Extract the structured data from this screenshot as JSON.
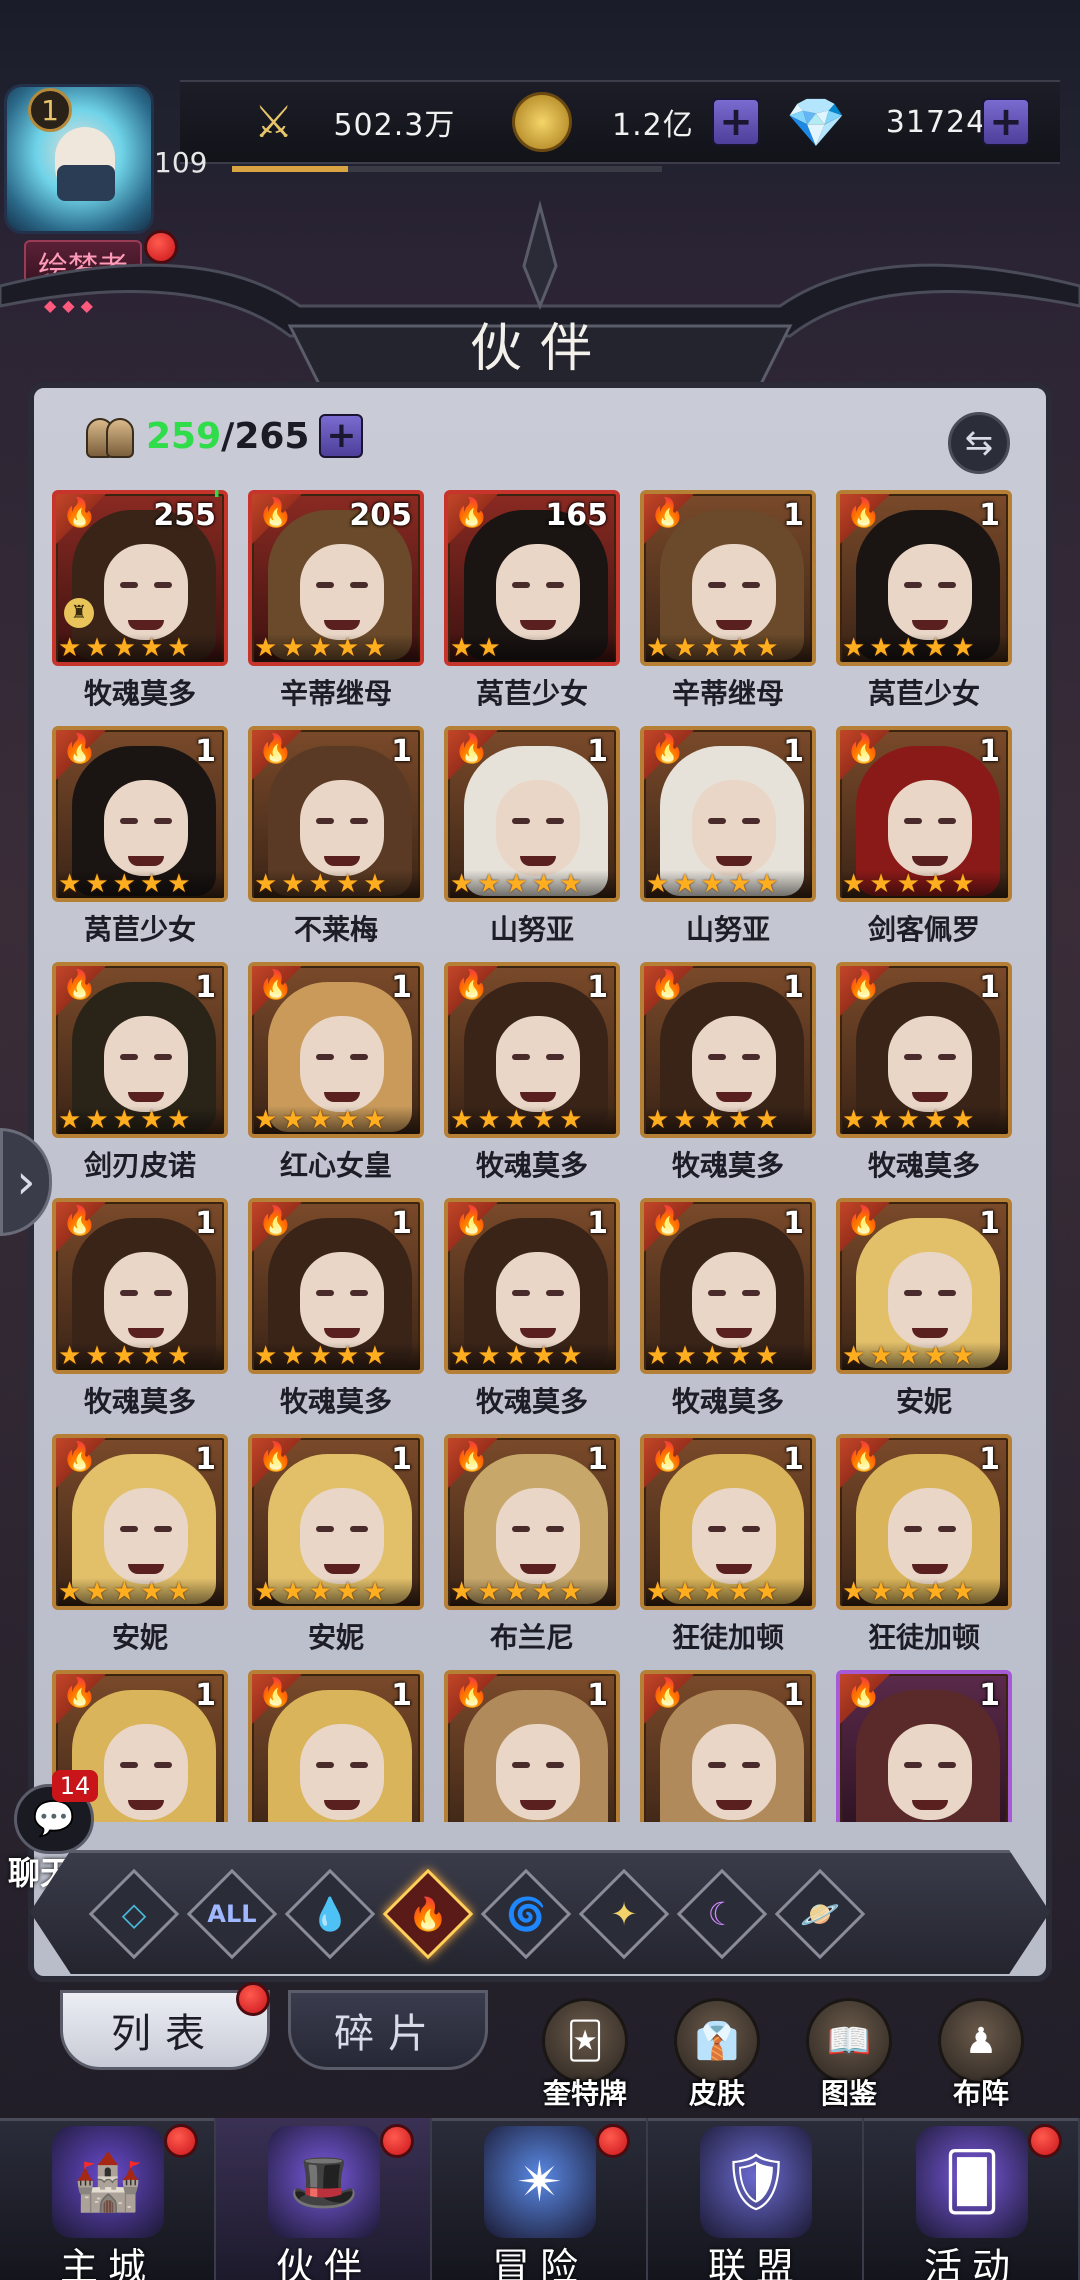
{
  "header": {
    "player_level": "109",
    "vip_level": "1",
    "title_badge": "绘梦者",
    "xp_progress": 0.27,
    "resources": [
      {
        "name": "power",
        "icon": "sword-icon",
        "value": "502.3万"
      },
      {
        "name": "gold",
        "icon": "coin-icon",
        "value": "1.2亿"
      },
      {
        "name": "diamond",
        "icon": "diamond-icon",
        "value": "31724"
      }
    ],
    "plus_symbol": "+"
  },
  "page": {
    "title": "伙伴",
    "owned": "259",
    "slash": "/",
    "capacity": "265",
    "sort_icon": "⇆"
  },
  "heroes": [
    {
      "name": "牧魂莫多",
      "level": "255",
      "stars": 5,
      "frame": "red",
      "hair": "#3a2418",
      "upgrade": true,
      "locked": true
    },
    {
      "name": "辛蒂继母",
      "level": "205",
      "stars": 5,
      "frame": "red",
      "hair": "#6a4a2a"
    },
    {
      "name": "莴苣少女",
      "level": "165",
      "stars": 2,
      "frame": "red",
      "hair": "#1a1412"
    },
    {
      "name": "辛蒂继母",
      "level": "1",
      "stars": 5,
      "frame": "gold",
      "hair": "#6a4a2a"
    },
    {
      "name": "莴苣少女",
      "level": "1",
      "stars": 5,
      "frame": "gold",
      "hair": "#1a1412"
    },
    {
      "name": "莴苣少女",
      "level": "1",
      "stars": 5,
      "frame": "gold",
      "hair": "#1a1412"
    },
    {
      "name": "不莱梅",
      "level": "1",
      "stars": 5,
      "frame": "gold",
      "hair": "#5a3a24"
    },
    {
      "name": "山努亚",
      "level": "1",
      "stars": 5,
      "frame": "gold",
      "hair": "#e6e2da"
    },
    {
      "name": "山努亚",
      "level": "1",
      "stars": 5,
      "frame": "gold",
      "hair": "#e6e2da"
    },
    {
      "name": "剑客佩罗",
      "level": "1",
      "stars": 5,
      "frame": "gold",
      "hair": "#8a1a18"
    },
    {
      "name": "剑刃皮诺",
      "level": "1",
      "stars": 5,
      "frame": "gold",
      "hair": "#2a2418"
    },
    {
      "name": "红心女皇",
      "level": "1",
      "stars": 5,
      "frame": "gold",
      "hair": "#c99a5a"
    },
    {
      "name": "牧魂莫多",
      "level": "1",
      "stars": 5,
      "frame": "gold",
      "hair": "#3a2418"
    },
    {
      "name": "牧魂莫多",
      "level": "1",
      "stars": 5,
      "frame": "gold",
      "hair": "#3a2418"
    },
    {
      "name": "牧魂莫多",
      "level": "1",
      "stars": 5,
      "frame": "gold",
      "hair": "#3a2418"
    },
    {
      "name": "牧魂莫多",
      "level": "1",
      "stars": 5,
      "frame": "gold",
      "hair": "#3a2418"
    },
    {
      "name": "牧魂莫多",
      "level": "1",
      "stars": 5,
      "frame": "gold",
      "hair": "#3a2418"
    },
    {
      "name": "牧魂莫多",
      "level": "1",
      "stars": 5,
      "frame": "gold",
      "hair": "#3a2418"
    },
    {
      "name": "牧魂莫多",
      "level": "1",
      "stars": 5,
      "frame": "gold",
      "hair": "#3a2418"
    },
    {
      "name": "安妮",
      "level": "1",
      "stars": 5,
      "frame": "gold",
      "hair": "#e2c06a"
    },
    {
      "name": "安妮",
      "level": "1",
      "stars": 5,
      "frame": "gold",
      "hair": "#e2c06a"
    },
    {
      "name": "安妮",
      "level": "1",
      "stars": 5,
      "frame": "gold",
      "hair": "#e2c06a"
    },
    {
      "name": "布兰尼",
      "level": "1",
      "stars": 5,
      "frame": "gold",
      "hair": "#c8a86a"
    },
    {
      "name": "狂徒加顿",
      "level": "1",
      "stars": 5,
      "frame": "gold",
      "hair": "#d9b45a"
    },
    {
      "name": "狂徒加顿",
      "level": "1",
      "stars": 5,
      "frame": "gold",
      "hair": "#d9b45a"
    },
    {
      "name": "",
      "level": "1",
      "stars": 0,
      "frame": "gold",
      "hair": "#d9b45a"
    },
    {
      "name": "",
      "level": "1",
      "stars": 0,
      "frame": "gold",
      "hair": "#d9b45a"
    },
    {
      "name": "",
      "level": "1",
      "stars": 0,
      "frame": "gold",
      "hair": "#b08a5a"
    },
    {
      "name": "",
      "level": "1",
      "stars": 0,
      "frame": "gold",
      "hair": "#b08a5a"
    },
    {
      "name": "",
      "level": "1",
      "stars": 0,
      "frame": "purple",
      "hair": "#5a2a2a"
    }
  ],
  "filters": [
    {
      "id": "light",
      "glyph": "◇",
      "color": "#4ab6d9"
    },
    {
      "id": "all",
      "glyph": "ALL",
      "color": "#9fb8ff"
    },
    {
      "id": "water",
      "glyph": "💧",
      "color": "#5aa6e6"
    },
    {
      "id": "fire",
      "glyph": "🔥",
      "color": "#ff7a3a",
      "active": true
    },
    {
      "id": "wind",
      "glyph": "🌀",
      "color": "#3ad98a"
    },
    {
      "id": "holy",
      "glyph": "✦",
      "color": "#f1d36a"
    },
    {
      "id": "dark",
      "glyph": "☾",
      "color": "#d08aff"
    },
    {
      "id": "void",
      "glyph": "🪐",
      "color": "#7a9aff"
    }
  ],
  "subtabs": {
    "list": "列表",
    "fragments": "碎片"
  },
  "tools": [
    {
      "id": "tarot",
      "label": "奎特牌",
      "icon": "🃏"
    },
    {
      "id": "skin",
      "label": "皮肤",
      "icon": "👔"
    },
    {
      "id": "codex",
      "label": "图鉴",
      "icon": "📖"
    },
    {
      "id": "formation",
      "label": "布阵",
      "icon": "♟"
    }
  ],
  "nav": [
    {
      "id": "city",
      "label": "主城",
      "icon": "🏰",
      "badge": true
    },
    {
      "id": "partners",
      "label": "伙伴",
      "icon": "🎩",
      "badge": true,
      "active": true
    },
    {
      "id": "adventure",
      "label": "冒险",
      "icon": "✴",
      "badge": true
    },
    {
      "id": "alliance",
      "label": "联盟",
      "icon": "🛡",
      "badge": false
    },
    {
      "id": "events",
      "label": "活动",
      "icon": "🂠",
      "badge": true
    }
  ],
  "chat": {
    "count": "14",
    "label": "聊天",
    "icon": "💬"
  },
  "side_arrow": "›"
}
